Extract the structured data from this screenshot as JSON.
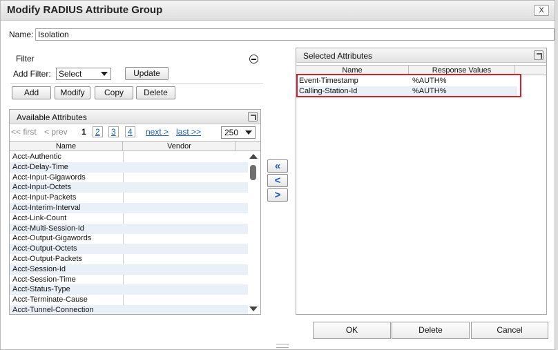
{
  "dialog": {
    "title": "Modify RADIUS Attribute Group",
    "close_label": "X"
  },
  "name": {
    "label": "Name:",
    "value": "Isolation"
  },
  "filter": {
    "title": "Filter",
    "add_filter_label": "Add Filter:",
    "select_value": "Select",
    "update_label": "Update",
    "buttons": {
      "add": "Add",
      "modify": "Modify",
      "copy": "Copy",
      "delete": "Delete"
    }
  },
  "available": {
    "title": "Available Attributes",
    "pager": {
      "first": "<< first",
      "prev": "< prev",
      "current": "1",
      "pages": [
        "2",
        "3",
        "4"
      ],
      "next": "next >",
      "last": "last >>",
      "per_page": "250"
    },
    "columns": [
      "Name",
      "Vendor"
    ],
    "rows": [
      "Acct-Authentic",
      "Acct-Delay-Time",
      "Acct-Input-Gigawords",
      "Acct-Input-Octets",
      "Acct-Input-Packets",
      "Acct-Interim-Interval",
      "Acct-Link-Count",
      "Acct-Multi-Session-Id",
      "Acct-Output-Gigawords",
      "Acct-Output-Octets",
      "Acct-Output-Packets",
      "Acct-Session-Id",
      "Acct-Session-Time",
      "Acct-Status-Type",
      "Acct-Terminate-Cause",
      "Acct-Tunnel-Connection"
    ]
  },
  "move_buttons": {
    "add_all": "«",
    "remove": "<",
    "add": ">"
  },
  "selected": {
    "title": "Selected Attributes",
    "columns": [
      "Name",
      "Response Values"
    ],
    "rows": [
      {
        "name": "Event-Timestamp",
        "value": "%AUTH%"
      },
      {
        "name": "Calling-Station-Id",
        "value": "%AUTH%"
      }
    ]
  },
  "footer": {
    "ok": "OK",
    "delete": "Delete",
    "cancel": "Cancel"
  },
  "colors": {
    "highlight": "#d3202a",
    "link": "#1a5fb4",
    "row_alt": "#eaf0f8"
  }
}
